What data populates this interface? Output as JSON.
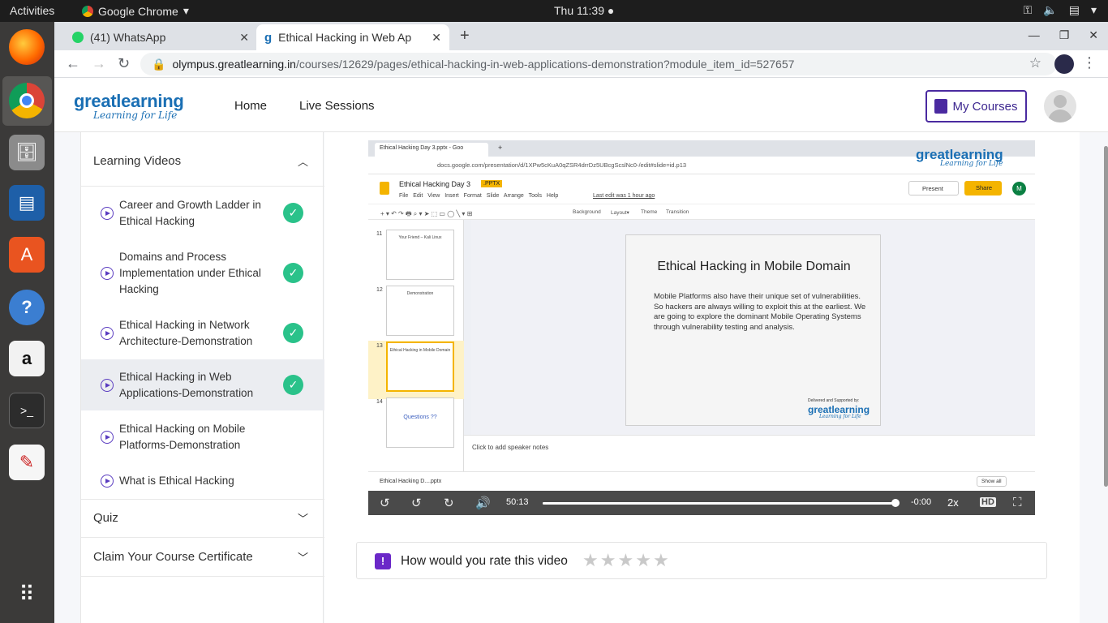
{
  "os": {
    "activities": "Activities",
    "app_name": "Google Chrome",
    "clock": "Thu 11:39 ●"
  },
  "dock": [
    "firefox-icon",
    "chrome-icon",
    "files-icon",
    "writer-icon",
    "software-center-icon",
    "help-icon",
    "amazon-icon",
    "terminal-icon",
    "document-viewer-icon",
    "app-grid-icon"
  ],
  "browser": {
    "tabs": [
      {
        "title": "(41) WhatsApp"
      },
      {
        "title": "Ethical Hacking in Web Ap"
      }
    ],
    "url_host": "olympus.greatlearning.in",
    "url_path": "/courses/12629/pages/ethical-hacking-in-web-applications-demonstration?module_item_id=527657"
  },
  "site": {
    "logo": "greatlearning",
    "logo_tag": "Learning for Life",
    "nav": [
      "Home",
      "Live Sessions"
    ],
    "my_courses": "My Courses"
  },
  "sidebar": {
    "learning_videos": "Learning Videos",
    "lessons": [
      {
        "title": "Career and Growth Ladder in Ethical Hacking",
        "done": true
      },
      {
        "title": "Domains and Process Implementation under Ethical Hacking",
        "done": true
      },
      {
        "title": "Ethical Hacking in Network Architecture-Demonstration",
        "done": true
      },
      {
        "title": "Ethical Hacking in Web Applications-Demonstration",
        "done": true
      },
      {
        "title": "Ethical Hacking on Mobile Platforms-Demonstration",
        "done": false
      },
      {
        "title": "What is Ethical Hacking",
        "done": false
      }
    ],
    "quiz": "Quiz",
    "certificate": "Claim Your Course Certificate"
  },
  "video": {
    "inner_tab": "Ethical Hacking Day 3.pptx - Goo",
    "inner_url": "docs.google.com/presentation/d/1XPw5cKuA0qZSR4drrDz5UBcgScslNc0-/edit#slide=id.p13",
    "doc_name": "Ethical Hacking Day 3",
    "doc_badge": ".PPTX",
    "doc_menu": "File Edit View Insert Format Slide Arrange Tools Help",
    "last_edit": "Last edit was 1 hour ago",
    "present": "Present",
    "share": "Share",
    "avatar_letter": "M",
    "watermark": "greatlearning",
    "watermark_tag": "Learning for Life",
    "toolbar": [
      "Background",
      "Layout▾",
      "Theme",
      "Transition"
    ],
    "thumbs": [
      {
        "num": "11",
        "title": "Your Friend – Kali Linux"
      },
      {
        "num": "12",
        "title": "Demonstration"
      },
      {
        "num": "13",
        "title": "Ethical Hacking in Mobile Domain"
      },
      {
        "num": "14",
        "title": "Questions ??"
      }
    ],
    "slide_title": "Ethical Hacking in Mobile Domain",
    "slide_body": "Mobile Platforms also have their unique set of vulnerabilities. So hackers are always willing to exploit this at the earliest. We are going to explore the dominant Mobile Operating Systems through vulnerability testing and analysis.",
    "slide_delivered": "Delivered and Supported by:",
    "slide_logo": "greatlearning",
    "slide_logo_tag": "Learning for Life",
    "notes_placeholder": "Click to add speaker notes",
    "download_file": "Ethical Hacking D....pptx",
    "show_all": "Show all",
    "current_time": "50:13",
    "remaining": "-0:00",
    "speed": "2x",
    "progress": 0.99
  },
  "rating": {
    "label": "How would you rate this video",
    "max_stars": 5,
    "value": 0
  }
}
